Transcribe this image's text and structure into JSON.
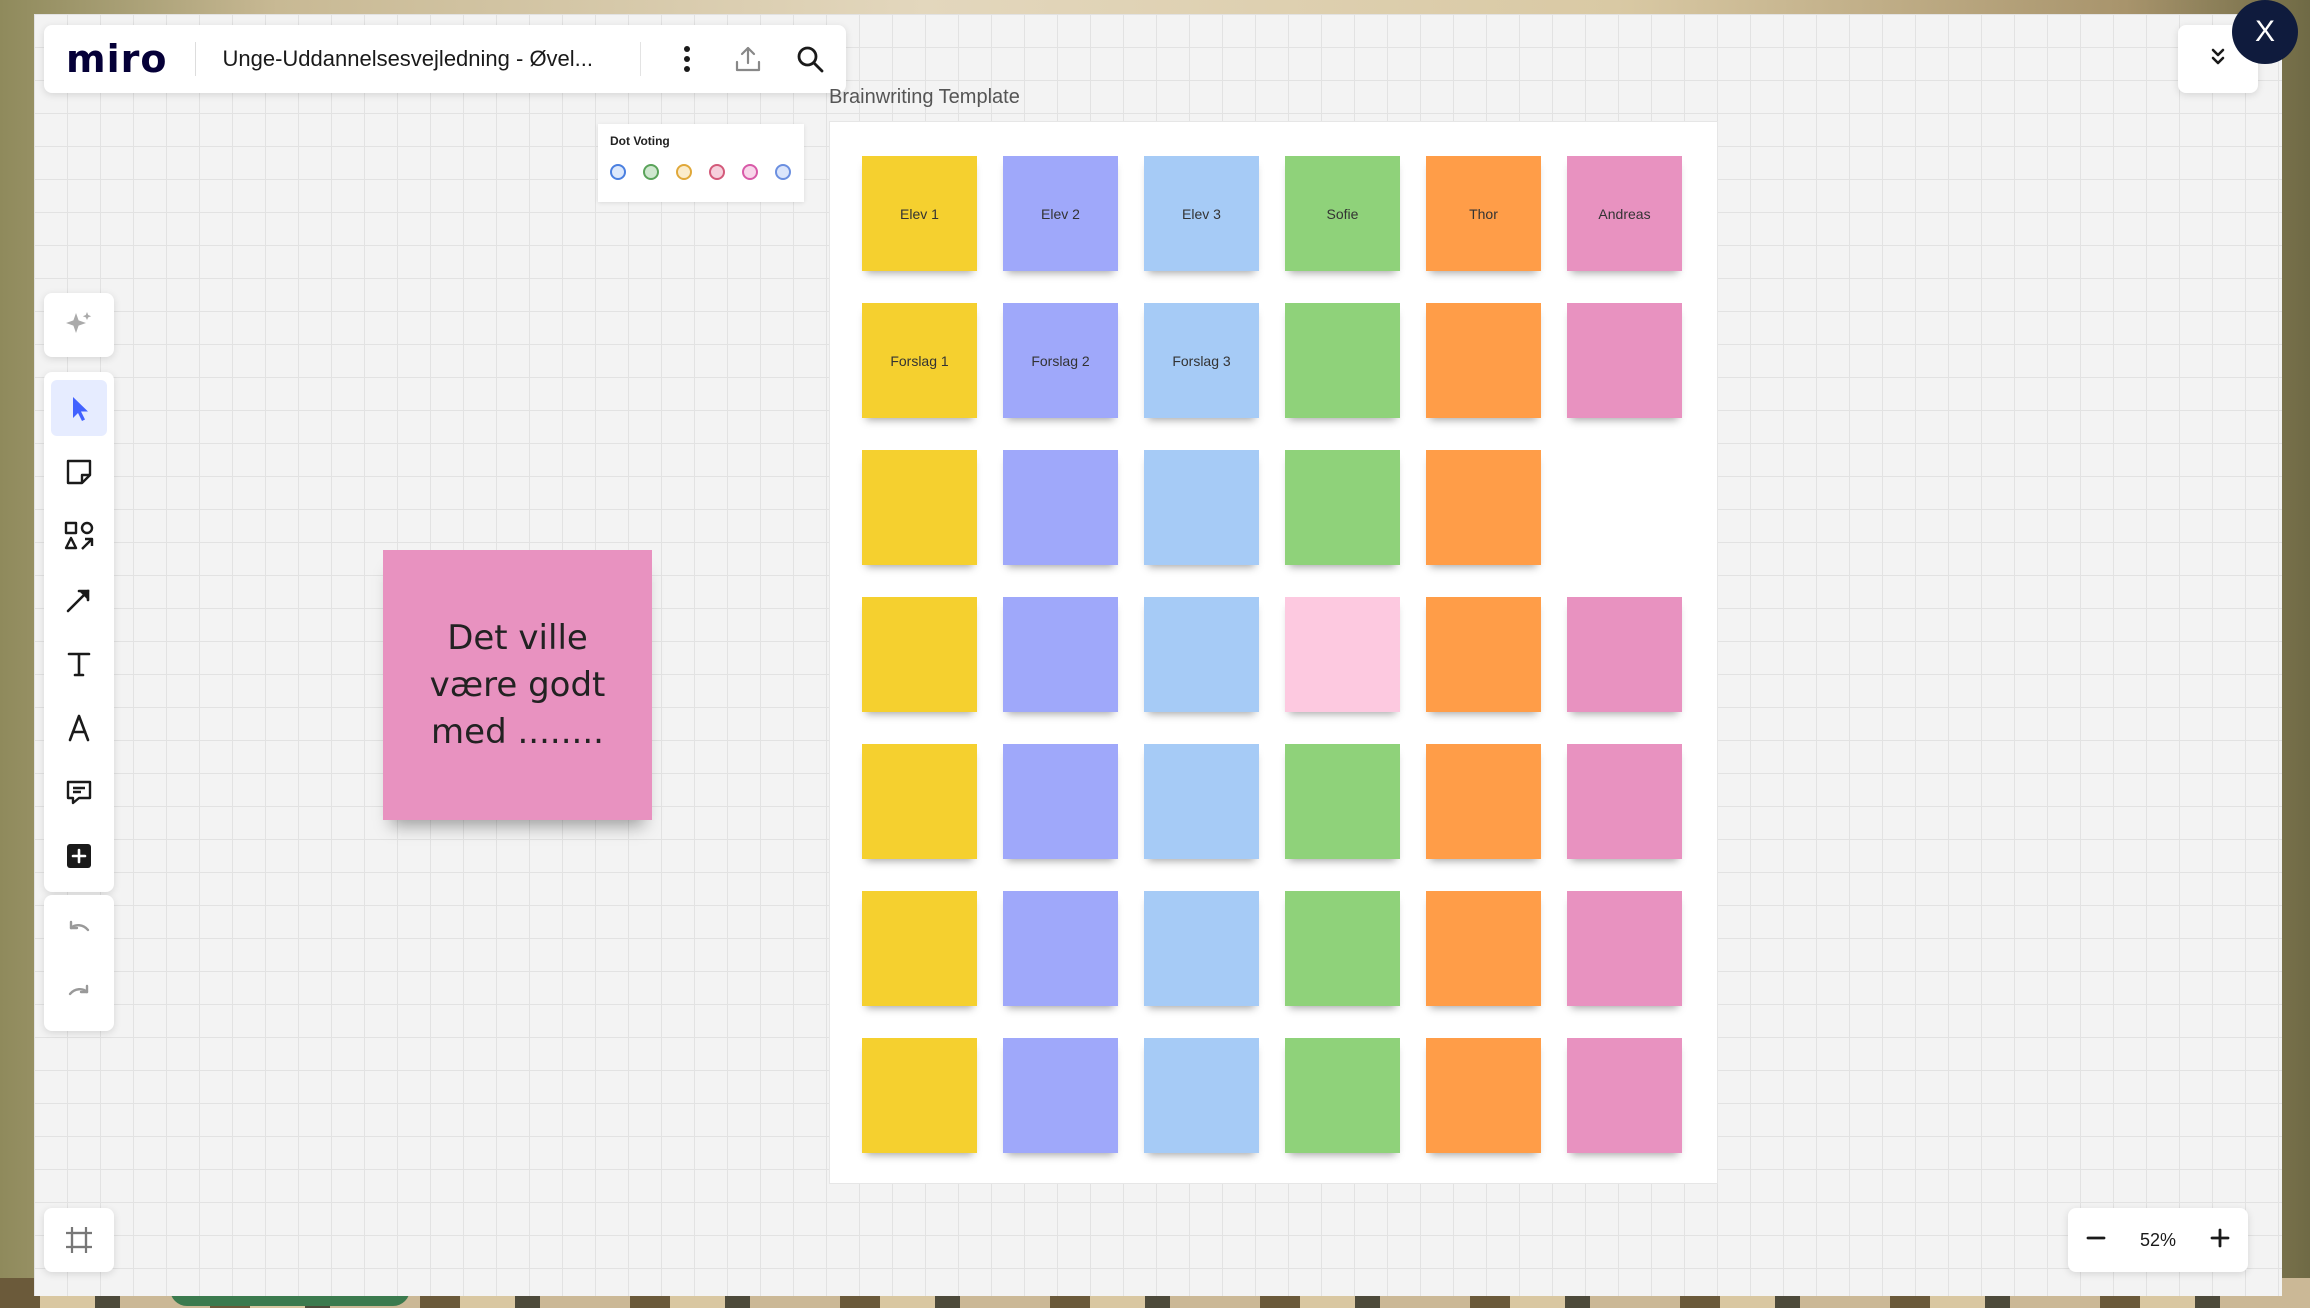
{
  "app": {
    "logo": "miro",
    "board_title": "Unge-Uddannelsesvejledning - Øvel..."
  },
  "topbar": {
    "icons": [
      "more-vertical-icon",
      "upload-icon",
      "search-icon"
    ]
  },
  "window": {
    "close_label": "X",
    "collapse_icon": "chevrons-down-icon"
  },
  "left_toolbar": {
    "group1": [
      "sparkle-ai-icon"
    ],
    "group2": [
      "select-cursor-icon",
      "sticky-note-icon",
      "shapes-icon",
      "connector-line-icon",
      "text-icon",
      "pen-icon",
      "comment-icon",
      "add-more-icon"
    ],
    "group3": [
      "undo-icon",
      "redo-icon"
    ],
    "bottom": [
      "frames-icon"
    ]
  },
  "zoom": {
    "minus": "−",
    "level": "52%",
    "plus": "+"
  },
  "dot_voting": {
    "title": "Dot Voting",
    "dots": [
      {
        "color": "#4a7fe0",
        "fill": "#dce8fb"
      },
      {
        "color": "#5aa35a",
        "fill": "#cfe7cf"
      },
      {
        "color": "#e0a83a",
        "fill": "#fbeccb"
      },
      {
        "color": "#d35a7a",
        "fill": "#f6d0dc"
      },
      {
        "color": "#d85aa8",
        "fill": "#f8d6ea"
      },
      {
        "color": "#6b8fe0",
        "fill": "#dbe5fb"
      }
    ]
  },
  "template": {
    "title": "Brainwriting Template",
    "colors": {
      "yellow": "#f5d02f",
      "violet": "#9fa8fa",
      "light_blue": "#a6cbf6",
      "green": "#8fd27a",
      "orange": "#ff9d48",
      "pink": "#e892c0",
      "light_pink": "#fdc9e0"
    },
    "rows": [
      [
        {
          "color": "yellow",
          "text": "Elev 1"
        },
        {
          "color": "violet",
          "text": "Elev  2"
        },
        {
          "color": "light_blue",
          "text": "Elev 3"
        },
        {
          "color": "green",
          "text": "Sofie"
        },
        {
          "color": "orange",
          "text": "Thor"
        },
        {
          "color": "pink",
          "text": "Andreas"
        }
      ],
      [
        {
          "color": "yellow",
          "text": "Forslag 1"
        },
        {
          "color": "violet",
          "text": "Forslag 2"
        },
        {
          "color": "light_blue",
          "text": "Forslag 3"
        },
        {
          "color": "green",
          "text": ""
        },
        {
          "color": "orange",
          "text": ""
        },
        {
          "color": "pink",
          "text": ""
        }
      ],
      [
        {
          "color": "yellow",
          "text": ""
        },
        {
          "color": "violet",
          "text": ""
        },
        {
          "color": "light_blue",
          "text": ""
        },
        {
          "color": "green",
          "text": ""
        },
        {
          "color": "orange",
          "text": ""
        },
        null
      ],
      [
        {
          "color": "yellow",
          "text": ""
        },
        {
          "color": "violet",
          "text": ""
        },
        {
          "color": "light_blue",
          "text": ""
        },
        {
          "color": "light_pink",
          "text": ""
        },
        {
          "color": "orange",
          "text": ""
        },
        {
          "color": "pink",
          "text": ""
        }
      ],
      [
        {
          "color": "yellow",
          "text": ""
        },
        {
          "color": "violet",
          "text": ""
        },
        {
          "color": "light_blue",
          "text": ""
        },
        {
          "color": "green",
          "text": ""
        },
        {
          "color": "orange",
          "text": ""
        },
        {
          "color": "pink",
          "text": ""
        }
      ],
      [
        {
          "color": "yellow",
          "text": ""
        },
        {
          "color": "violet",
          "text": ""
        },
        {
          "color": "light_blue",
          "text": ""
        },
        {
          "color": "green",
          "text": ""
        },
        {
          "color": "orange",
          "text": ""
        },
        {
          "color": "pink",
          "text": ""
        }
      ],
      [
        {
          "color": "yellow",
          "text": ""
        },
        {
          "color": "violet",
          "text": ""
        },
        {
          "color": "light_blue",
          "text": ""
        },
        {
          "color": "green",
          "text": ""
        },
        {
          "color": "orange",
          "text": ""
        },
        {
          "color": "pink",
          "text": ""
        }
      ]
    ]
  },
  "big_sticky": {
    "text": "Det ville være godt med ........",
    "color": "#e892c0"
  }
}
